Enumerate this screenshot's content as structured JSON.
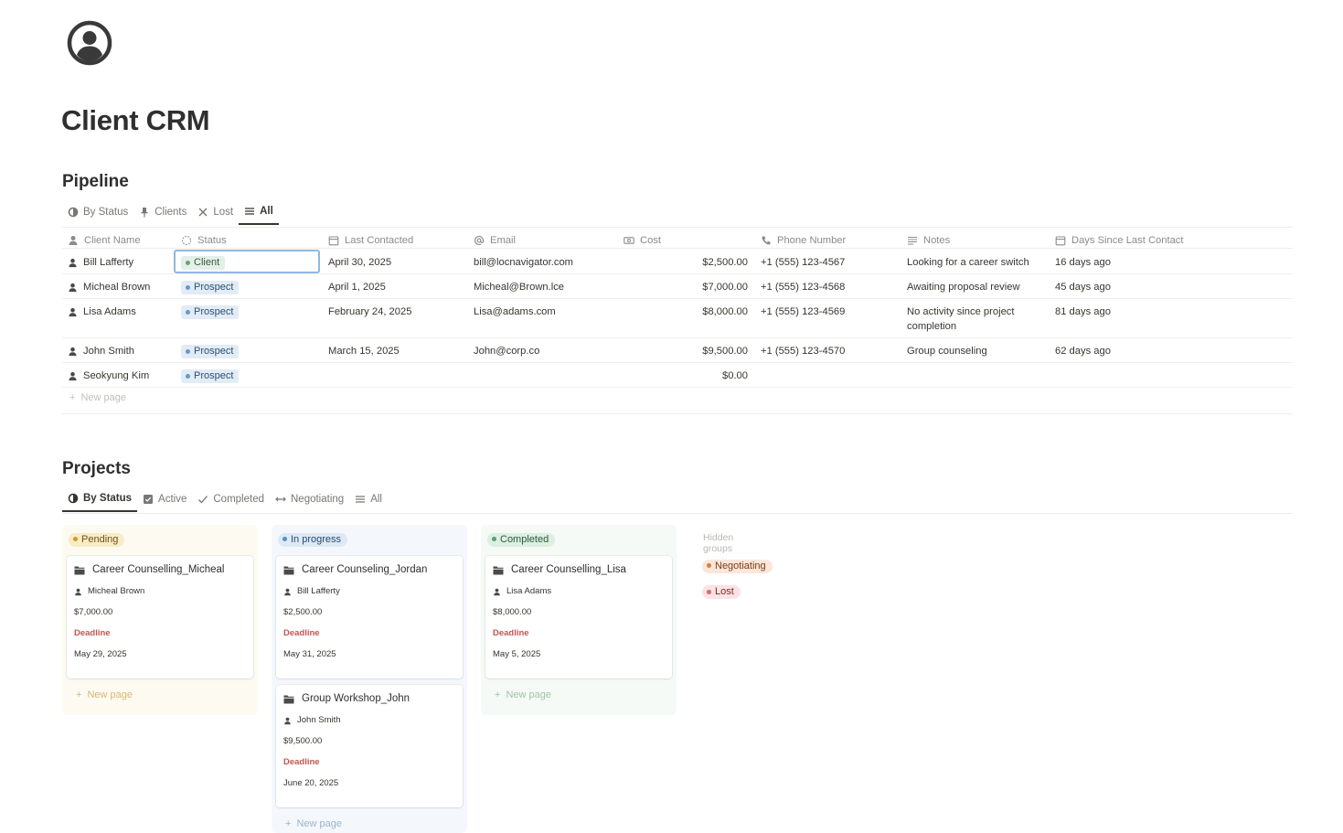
{
  "page": {
    "title": "Client CRM",
    "icon": "person-circle-icon"
  },
  "pipeline": {
    "title": "Pipeline",
    "tabs": [
      {
        "label": "By Status",
        "icon": "status-icon"
      },
      {
        "label": "Clients",
        "icon": "pin-icon"
      },
      {
        "label": "Lost",
        "icon": "close-icon"
      },
      {
        "label": "All",
        "icon": "list-icon",
        "active": true
      }
    ],
    "columns": {
      "name": "Client Name",
      "status": "Status",
      "last": "Last Contacted",
      "email": "Email",
      "cost": "Cost",
      "phone": "Phone Number",
      "notes": "Notes",
      "days": "Days Since Last Contact"
    },
    "rows": [
      {
        "name": "Bill Lafferty",
        "status": "Client",
        "last": "April 30, 2025",
        "email": "bill@locnavigator.com",
        "cost": "$2,500.00",
        "phone": "+1 (555) 123-4567",
        "notes": "Looking for a career switch",
        "days": "16 days ago"
      },
      {
        "name": "Micheal Brown",
        "status": "Prospect",
        "last": "April 1, 2025",
        "email": "Micheal@Brown.lce",
        "cost": "$7,000.00",
        "phone": "+1 (555) 123-4568",
        "notes": "Awaiting proposal review",
        "days": "45 days ago"
      },
      {
        "name": "Lisa Adams",
        "status": "Prospect",
        "last": "February 24, 2025",
        "email": "Lisa@adams.com",
        "cost": "$8,000.00",
        "phone": "+1 (555) 123-4569",
        "notes": "No activity since project completion",
        "days": "81 days ago"
      },
      {
        "name": "John Smith",
        "status": "Prospect",
        "last": "March 15, 2025",
        "email": "John@corp.co",
        "cost": "$9,500.00",
        "phone": "+1 (555) 123-4570",
        "notes": "Group counseling",
        "days": "62 days ago"
      },
      {
        "name": "Seokyung Kim",
        "status": "Prospect",
        "last": "",
        "email": "",
        "cost": "$0.00",
        "phone": "",
        "notes": "",
        "days": ""
      }
    ],
    "new_page": "New page"
  },
  "projects": {
    "title": "Projects",
    "tabs": [
      {
        "label": "By Status",
        "icon": "status-icon",
        "active": true
      },
      {
        "label": "Active",
        "icon": "checkbox-icon"
      },
      {
        "label": "Completed",
        "icon": "check-icon"
      },
      {
        "label": "Negotiating",
        "icon": "arrows-icon"
      },
      {
        "label": "All",
        "icon": "list-icon"
      }
    ],
    "groups": [
      {
        "label": "Pending",
        "cards": [
          {
            "title": "Career Counselling_Micheal",
            "person": "Micheal Brown",
            "cost": "$7,000.00",
            "deadline_label": "Deadline",
            "deadline": "May 29, 2025"
          }
        ],
        "new_page": "New page"
      },
      {
        "label": "In progress",
        "cards": [
          {
            "title": "Career Counseling_Jordan",
            "person": "Bill Lafferty",
            "cost": "$2,500.00",
            "deadline_label": "Deadline",
            "deadline": "May 31, 2025"
          },
          {
            "title": "Group Workshop_John",
            "person": "John Smith",
            "cost": "$9,500.00",
            "deadline_label": "Deadline",
            "deadline": "June 20, 2025"
          }
        ],
        "new_page": "New page"
      },
      {
        "label": "Completed",
        "cards": [
          {
            "title": "Career Counselling_Lisa",
            "person": "Lisa Adams",
            "cost": "$8,000.00",
            "deadline_label": "Deadline",
            "deadline": "May 5, 2025"
          }
        ],
        "new_page": "New page"
      }
    ],
    "hidden_groups": {
      "label": "Hidden groups",
      "items": [
        "Negotiating",
        "Lost"
      ]
    }
  }
}
